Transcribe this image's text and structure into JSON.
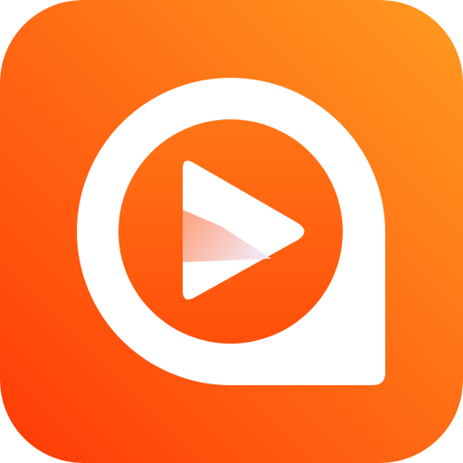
{
  "icon": {
    "name": "video-player-app-icon",
    "symbol": "play-icon",
    "colors": {
      "tile_top_right": "#FF9A1F",
      "tile_mid": "#FF6A14",
      "tile_bottom_left": "#FF3A06",
      "bubble": "#FFFFFF",
      "inner_circle_top": "#FF7516",
      "inner_circle_bottom": "#FF4F0B",
      "play_main": "#FFFFFF",
      "play_shadow_left": "#FF9A73",
      "play_shadow_right": "#F2E2EC"
    }
  }
}
